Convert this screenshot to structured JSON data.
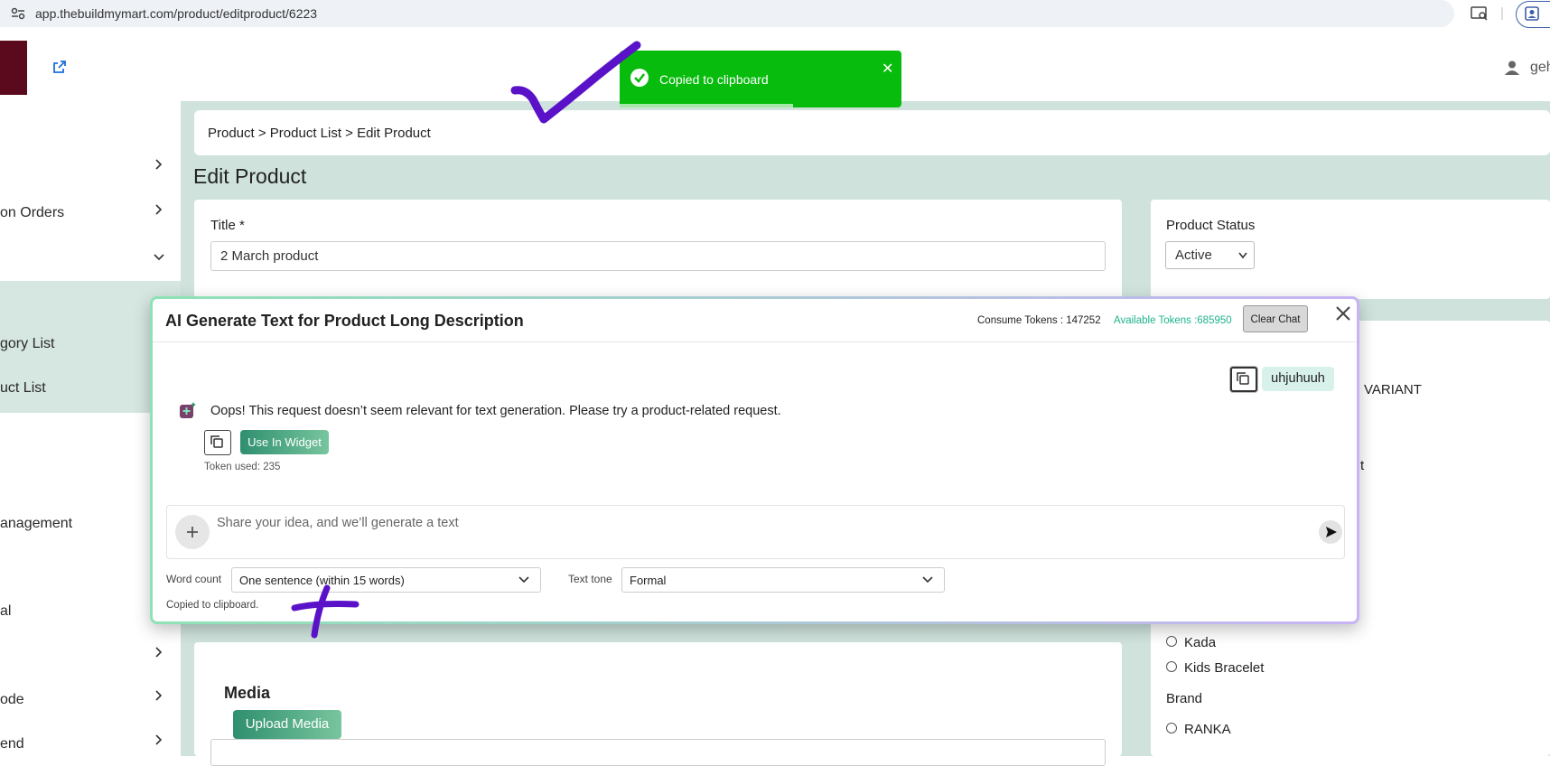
{
  "browser": {
    "url": "app.thebuildmymart.com/product/editproduct/6223"
  },
  "header": {
    "username": "geh"
  },
  "toast": {
    "text": "Copied to clipboard",
    "color": "#07bc0c"
  },
  "breadcrumb": "Product > Product List > Edit Product",
  "page_title": "Edit Product",
  "sidebar": {
    "items": [
      {
        "label": "on Orders"
      },
      {
        "label": "gory List"
      },
      {
        "label": "uct List"
      },
      {
        "label": "anagement"
      },
      {
        "label": "al"
      },
      {
        "label": "ode"
      },
      {
        "label": "end"
      }
    ]
  },
  "form": {
    "title_label": "Title *",
    "title_value": "2 March product",
    "status_label": "Product Status",
    "status_value": "Active"
  },
  "right_panel": {
    "variant_text": "VARIANT",
    "partial_t": "t",
    "categories": [
      "Kada",
      "Kids Bracelet"
    ],
    "brand_label": "Brand",
    "brands": [
      "RANKA"
    ]
  },
  "modal": {
    "title": "AI Generate Text for Product Long Description",
    "consume_tokens": "Consume Tokens : 147252",
    "available_tokens": "Available Tokens :685950",
    "clear_chat": "Clear Chat",
    "user_message": "uhjuhuuh",
    "ai_message": "Oops! This request doesn’t seem relevant for text generation. Please try a product-related request.",
    "use_in_widget": "Use In Widget",
    "token_used": "Token used: 235",
    "input_placeholder": "Share your idea, and we’ll generate a text",
    "word_count_label": "Word count",
    "word_count_value": "One sentence (within 15 words)",
    "text_tone_label": "Text tone",
    "text_tone_value": "Formal",
    "copied_note": "Copied to clipboard."
  },
  "media": {
    "title": "Media",
    "upload_button": "Upload Media"
  },
  "colors": {
    "accent_green": "#2f8f6f",
    "content_bg": "#cfe3dc",
    "annotation_purple": "#5a12c8"
  }
}
